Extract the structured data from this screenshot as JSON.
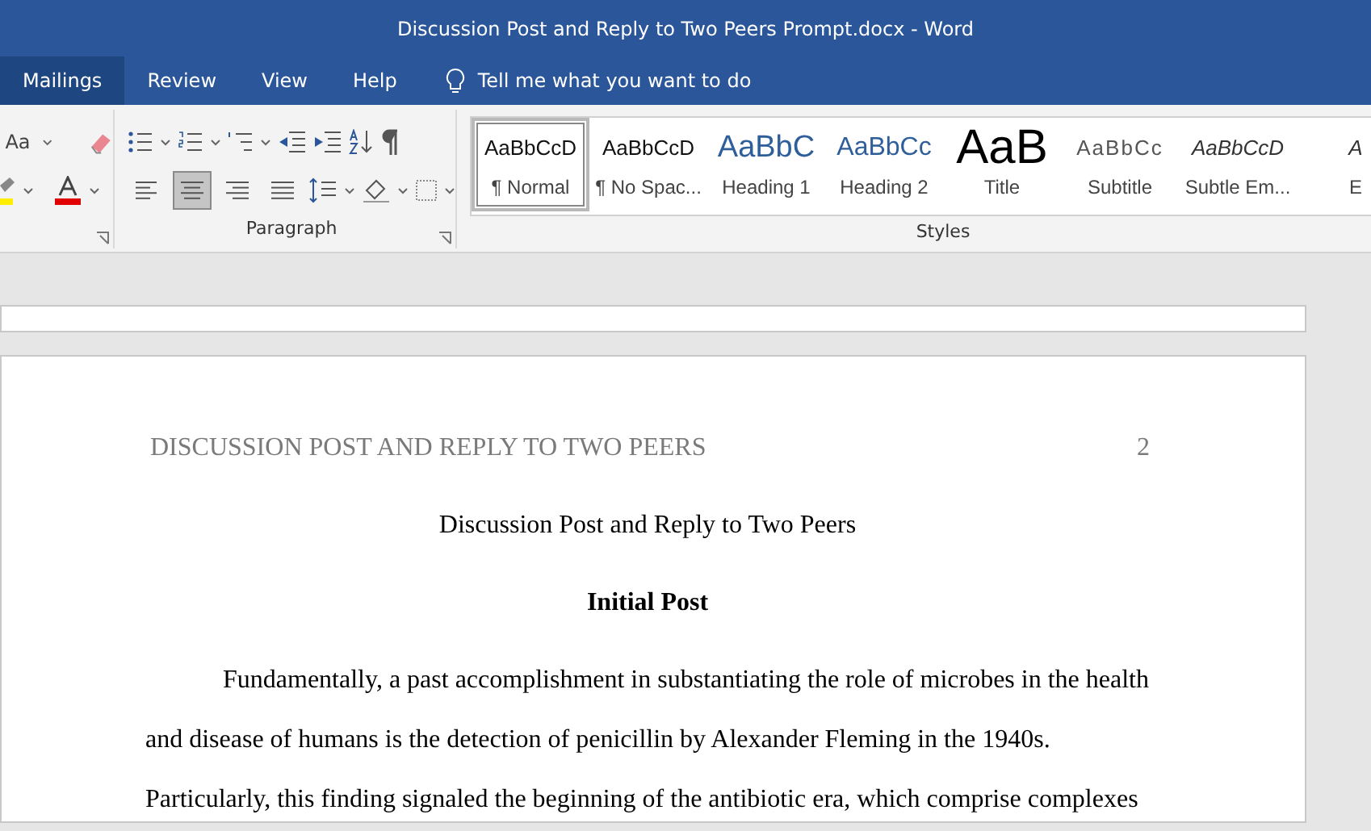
{
  "window": {
    "title": "Discussion Post and Reply to Two Peers Prompt.docx  -  Word"
  },
  "ribbon_tabs": [
    {
      "label": "Mailings",
      "selected": true
    },
    {
      "label": "Review",
      "selected": false
    },
    {
      "label": "View",
      "selected": false
    },
    {
      "label": "Help",
      "selected": false
    }
  ],
  "tell_me": {
    "label": "Tell me what you want to do"
  },
  "font_group": {
    "change_case": "Aa"
  },
  "paragraph_group": {
    "label": "Paragraph",
    "alignments": [
      {
        "kind": "left",
        "selected": false
      },
      {
        "kind": "center",
        "selected": true
      },
      {
        "kind": "right",
        "selected": false
      },
      {
        "kind": "justify",
        "selected": false
      }
    ]
  },
  "styles_group": {
    "label": "Styles",
    "styles": [
      {
        "kind": "normal",
        "preview": "AaBbCcD",
        "name": "¶ Normal",
        "selected": true
      },
      {
        "kind": "normal",
        "preview": "AaBbCcD",
        "name": "¶ No Spac...",
        "selected": false
      },
      {
        "kind": "heading1",
        "preview": "AaBbC",
        "name": "Heading 1",
        "selected": false
      },
      {
        "kind": "heading2",
        "preview": "AaBbCc",
        "name": "Heading 2",
        "selected": false
      },
      {
        "kind": "title",
        "preview": "AaB",
        "name": "Title",
        "selected": false
      },
      {
        "kind": "subtitle",
        "preview": "AaBbCc",
        "name": "Subtitle",
        "selected": false
      },
      {
        "kind": "emphasis",
        "preview": "AaBbCcD",
        "name": "Subtle Em...",
        "selected": false
      },
      {
        "kind": "emphasis",
        "preview": "A",
        "name": "E",
        "selected": false
      }
    ]
  },
  "document": {
    "header": "DISCUSSION POST AND REPLY TO TWO PEERS",
    "page_number": "2",
    "title": "Discussion Post and Reply to Two Peers",
    "heading": "Initial Post",
    "paragraphs": [
      "Fundamentally, a past accomplishment in substantiating the role of microbes in the health and disease of humans is the detection of penicillin by Alexander Fleming in the 1940s. Particularly, this finding signaled the beginning of the antibiotic era, which comprise complexes"
    ]
  }
}
